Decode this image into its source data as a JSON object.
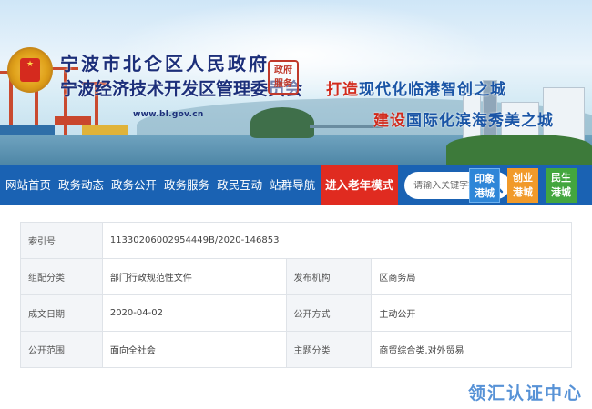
{
  "header": {
    "title": "宁波市北仑区人民政府",
    "subtitle": "宁波经济技术开发区管理委员会",
    "url": "www.bl.gov.cn",
    "seal_text": [
      "政府",
      "服务"
    ],
    "slogan1": {
      "red": "打造",
      "blue": "现代化临港智创之城"
    },
    "slogan2": {
      "red": "建设",
      "blue": "国际化滨海秀美之城"
    }
  },
  "nav": {
    "items": [
      "网站首页",
      "政务动态",
      "政务公开",
      "政务服务",
      "政民互动",
      "站群导航"
    ],
    "elder_mode": "进入老年模式"
  },
  "search": {
    "placeholder": "请输入关键字搜索"
  },
  "tiles": [
    {
      "line1": "印象",
      "line2": "港城",
      "color": "#2e86d8"
    },
    {
      "line1": "创业",
      "line2": "港城",
      "color": "#f19a2a"
    },
    {
      "line1": "民生",
      "line2": "港城",
      "color": "#43a63e"
    }
  ],
  "info": {
    "rows": [
      {
        "k1": "索引号",
        "v1": "11330206002954449B/2020-146853",
        "k2": "",
        "v2": ""
      },
      {
        "k1": "组配分类",
        "v1": "部门行政规范性文件",
        "k2": "发布机构",
        "v2": "区商务局"
      },
      {
        "k1": "成文日期",
        "v1": "2020-04-02",
        "k2": "公开方式",
        "v2": "主动公开"
      },
      {
        "k1": "公开范围",
        "v1": "面向全社会",
        "k2": "主题分类",
        "v2": "商贸综合类,对外贸易"
      }
    ]
  },
  "watermark": "领汇认证中心"
}
